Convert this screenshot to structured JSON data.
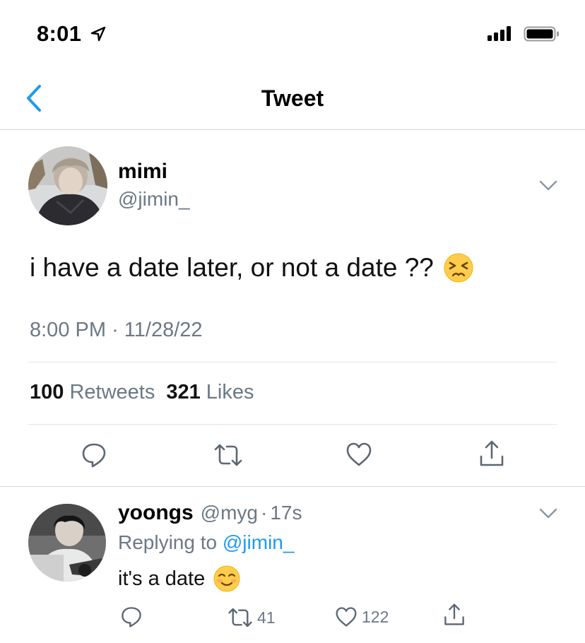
{
  "status_bar": {
    "time": "8:01"
  },
  "nav": {
    "title": "Tweet"
  },
  "tweet": {
    "display_name": "mimi",
    "handle": "@jimin_",
    "text": "i have a date later, or not a date ??",
    "emoji": "persevering-face-emoji",
    "time": "8:00 PM",
    "separator": "·",
    "date": "11/28/22",
    "retweets_count": "100",
    "retweets_label": "Retweets",
    "likes_count": "321",
    "likes_label": "Likes"
  },
  "reply": {
    "display_name": "yoongs",
    "handle": "@myg",
    "separator": "·",
    "age": "17s",
    "replying_prefix": "Replying to",
    "replying_handle": "@jimin_",
    "text": "it's a date",
    "emoji": "smiling-face-emoji",
    "retweets": "41",
    "likes": "122"
  },
  "colors": {
    "accent": "#1d9bf0",
    "secondary_text": "#6b7886",
    "divider": "#d8d8d8"
  },
  "icons": [
    "location-arrow-icon",
    "signal-icon",
    "battery-icon",
    "back-chevron-icon",
    "chevron-down-icon",
    "reply-icon",
    "retweet-icon",
    "like-icon",
    "share-icon"
  ]
}
